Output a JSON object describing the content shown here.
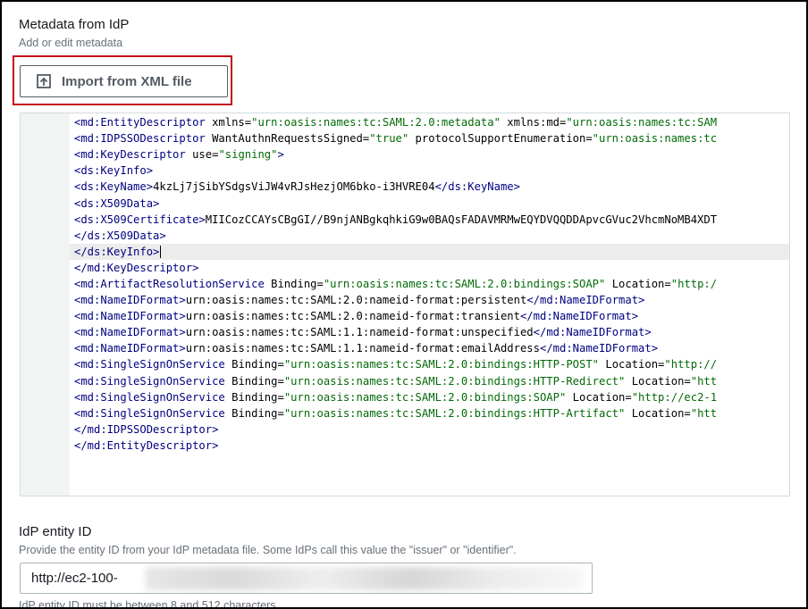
{
  "metadata_section": {
    "title": "Metadata from IdP",
    "description": "Add or edit metadata",
    "import_button_label": "Import from XML file",
    "icon": "upload-icon"
  },
  "editor": {
    "active_line": 9,
    "lines": [
      [
        {
          "t": "tag",
          "v": "<md:EntityDescriptor"
        },
        {
          "t": "attr",
          "v": " xmlns="
        },
        {
          "t": "val",
          "v": "\"urn:oasis:names:tc:SAML:2.0:metadata\""
        },
        {
          "t": "attr",
          "v": " xmlns:md="
        },
        {
          "t": "val",
          "v": "\"urn:oasis:names:tc:SAM"
        }
      ],
      [
        {
          "t": "tag",
          "v": "<md:IDPSSODescriptor"
        },
        {
          "t": "attr",
          "v": " WantAuthnRequestsSigned="
        },
        {
          "t": "val",
          "v": "\"true\""
        },
        {
          "t": "attr",
          "v": " protocolSupportEnumeration="
        },
        {
          "t": "val",
          "v": "\"urn:oasis:names:tc"
        }
      ],
      [
        {
          "t": "tag",
          "v": "<md:KeyDescriptor"
        },
        {
          "t": "attr",
          "v": " use="
        },
        {
          "t": "val",
          "v": "\"signing\""
        },
        {
          "t": "tag",
          "v": ">"
        }
      ],
      [
        {
          "t": "tag",
          "v": "<ds:KeyInfo>"
        }
      ],
      [
        {
          "t": "tag",
          "v": "<ds:KeyName>"
        },
        {
          "t": "txt",
          "v": "4kzLj7jSibYSdgsViJW4vRJsHezjOM6bko-i3HVRE04"
        },
        {
          "t": "tag",
          "v": "</ds:KeyName>"
        }
      ],
      [
        {
          "t": "tag",
          "v": "<ds:X509Data>"
        }
      ],
      [
        {
          "t": "tag",
          "v": "<ds:X509Certificate>"
        },
        {
          "t": "txt",
          "v": "MIICozCCAYsCBgGI//B9njANBgkqhkiG9w0BAQsFADAVMRMwEQYDVQQDDApvcGVuc2VhcmNoMB4XDT"
        }
      ],
      [
        {
          "t": "tag",
          "v": "</ds:X509Data>"
        }
      ],
      [
        {
          "t": "tag",
          "v": "</ds:KeyInfo>"
        }
      ],
      [
        {
          "t": "tag",
          "v": "</md:KeyDescriptor>"
        }
      ],
      [
        {
          "t": "tag",
          "v": "<md:ArtifactResolutionService"
        },
        {
          "t": "attr",
          "v": " Binding="
        },
        {
          "t": "val",
          "v": "\"urn:oasis:names:tc:SAML:2.0:bindings:SOAP\""
        },
        {
          "t": "attr",
          "v": " Location="
        },
        {
          "t": "val",
          "v": "\"http:/"
        }
      ],
      [
        {
          "t": "tag",
          "v": "<md:NameIDFormat>"
        },
        {
          "t": "txt",
          "v": "urn:oasis:names:tc:SAML:2.0:nameid-format:persistent"
        },
        {
          "t": "tag",
          "v": "</md:NameIDFormat>"
        }
      ],
      [
        {
          "t": "tag",
          "v": "<md:NameIDFormat>"
        },
        {
          "t": "txt",
          "v": "urn:oasis:names:tc:SAML:2.0:nameid-format:transient"
        },
        {
          "t": "tag",
          "v": "</md:NameIDFormat>"
        }
      ],
      [
        {
          "t": "tag",
          "v": "<md:NameIDFormat>"
        },
        {
          "t": "txt",
          "v": "urn:oasis:names:tc:SAML:1.1:nameid-format:unspecified"
        },
        {
          "t": "tag",
          "v": "</md:NameIDFormat>"
        }
      ],
      [
        {
          "t": "tag",
          "v": "<md:NameIDFormat>"
        },
        {
          "t": "txt",
          "v": "urn:oasis:names:tc:SAML:1.1:nameid-format:emailAddress"
        },
        {
          "t": "tag",
          "v": "</md:NameIDFormat>"
        }
      ],
      [
        {
          "t": "tag",
          "v": "<md:SingleSignOnService"
        },
        {
          "t": "attr",
          "v": " Binding="
        },
        {
          "t": "val",
          "v": "\"urn:oasis:names:tc:SAML:2.0:bindings:HTTP-POST\""
        },
        {
          "t": "attr",
          "v": " Location="
        },
        {
          "t": "val",
          "v": "\"http://"
        }
      ],
      [
        {
          "t": "tag",
          "v": "<md:SingleSignOnService"
        },
        {
          "t": "attr",
          "v": " Binding="
        },
        {
          "t": "val",
          "v": "\"urn:oasis:names:tc:SAML:2.0:bindings:HTTP-Redirect\""
        },
        {
          "t": "attr",
          "v": " Location="
        },
        {
          "t": "val",
          "v": "\"htt"
        }
      ],
      [
        {
          "t": "tag",
          "v": "<md:SingleSignOnService"
        },
        {
          "t": "attr",
          "v": " Binding="
        },
        {
          "t": "val",
          "v": "\"urn:oasis:names:tc:SAML:2.0:bindings:SOAP\""
        },
        {
          "t": "attr",
          "v": " Location="
        },
        {
          "t": "val",
          "v": "\"http://ec2-1"
        }
      ],
      [
        {
          "t": "tag",
          "v": "<md:SingleSignOnService"
        },
        {
          "t": "attr",
          "v": " Binding="
        },
        {
          "t": "val",
          "v": "\"urn:oasis:names:tc:SAML:2.0:bindings:HTTP-Artifact\""
        },
        {
          "t": "attr",
          "v": " Location="
        },
        {
          "t": "val",
          "v": "\"htt"
        }
      ],
      [
        {
          "t": "tag",
          "v": "</md:IDPSSODescriptor>"
        }
      ],
      [
        {
          "t": "tag",
          "v": "</md:EntityDescriptor>"
        }
      ]
    ],
    "fold_lines": [
      1,
      2,
      3,
      4,
      6
    ]
  },
  "entity_section": {
    "title": "IdP entity ID",
    "description": "Provide the entity ID from your IdP metadata file. Some IdPs call this value the \"issuer\" or \"identifier\".",
    "input_value": "http://ec2-100-",
    "hint_text": "IdP entity ID must be between 8 and 512 characters"
  },
  "colors": {
    "highlight": "#c40f19",
    "tag": "#000080",
    "value": "#036a07"
  }
}
